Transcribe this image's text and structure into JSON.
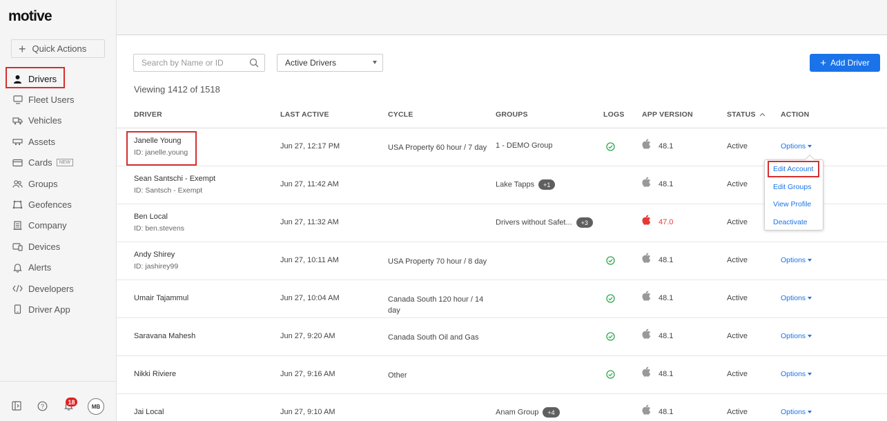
{
  "brand": {
    "logo_text": "motive"
  },
  "sidebar": {
    "quick_actions": "Quick Actions",
    "items": [
      {
        "label": "Drivers",
        "icon": "person-icon"
      },
      {
        "label": "Fleet Users",
        "icon": "monitor-icon"
      },
      {
        "label": "Vehicles",
        "icon": "truck-icon"
      },
      {
        "label": "Assets",
        "icon": "trailer-icon"
      },
      {
        "label": "Cards",
        "icon": "card-icon",
        "badge": "NEW"
      },
      {
        "label": "Groups",
        "icon": "groups-icon"
      },
      {
        "label": "Geofences",
        "icon": "geofence-icon"
      },
      {
        "label": "Company",
        "icon": "building-icon"
      },
      {
        "label": "Devices",
        "icon": "devices-icon"
      },
      {
        "label": "Alerts",
        "icon": "bell-icon"
      },
      {
        "label": "Developers",
        "icon": "code-icon"
      },
      {
        "label": "Driver App",
        "icon": "phone-icon"
      }
    ],
    "footer": {
      "notifications_count": "18",
      "avatar_initials": "MB"
    }
  },
  "toolbar": {
    "search_placeholder": "Search by Name or ID",
    "filter_selected": "Active Drivers",
    "add_driver": "Add Driver",
    "viewing": "Viewing 1412 of 1518"
  },
  "table": {
    "headers": [
      "DRIVER",
      "LAST ACTIVE",
      "CYCLE",
      "GROUPS",
      "LOGS",
      "APP VERSION",
      "STATUS",
      "ACTION"
    ],
    "rows": [
      {
        "name": "Janelle Young",
        "id": "ID: janelle.young",
        "last_active": "Jun 27, 12:17 PM",
        "cycle": "USA Property 60 hour / 7 day",
        "group": "1 - DEMO Group",
        "pill": "",
        "logs_ok": true,
        "version": "48.1",
        "version_bad": false,
        "status": "Active",
        "action": "Options"
      },
      {
        "name": "Sean Santschi - Exempt",
        "id": "ID: Santsch - Exempt",
        "last_active": "Jun 27, 11:42 AM",
        "cycle": "",
        "group": "Lake Tapps",
        "pill": "+1",
        "logs_ok": false,
        "version": "48.1",
        "version_bad": false,
        "status": "Active",
        "action": ""
      },
      {
        "name": "Ben Local",
        "id": "ID: ben.stevens",
        "last_active": "Jun 27, 11:32 AM",
        "cycle": "",
        "group": "Drivers without Safet...",
        "pill": "+3",
        "logs_ok": false,
        "version": "47.0",
        "version_bad": true,
        "status": "Active",
        "action": ""
      },
      {
        "name": "Andy Shirey",
        "id": "ID: jashirey99",
        "last_active": "Jun 27, 10:11 AM",
        "cycle": "USA Property 70 hour / 8 day",
        "group": "",
        "pill": "",
        "logs_ok": true,
        "version": "48.1",
        "version_bad": false,
        "status": "Active",
        "action": "Options"
      },
      {
        "name": "Umair Tajammul",
        "id": "",
        "last_active": "Jun 27, 10:04 AM",
        "cycle": "Canada South 120 hour / 14 day",
        "group": "",
        "pill": "",
        "logs_ok": true,
        "version": "48.1",
        "version_bad": false,
        "status": "Active",
        "action": "Options"
      },
      {
        "name": "Saravana Mahesh",
        "id": "",
        "last_active": "Jun 27, 9:20 AM",
        "cycle": "Canada South Oil and Gas",
        "group": "",
        "pill": "",
        "logs_ok": true,
        "version": "48.1",
        "version_bad": false,
        "status": "Active",
        "action": "Options"
      },
      {
        "name": "Nikki Riviere",
        "id": "",
        "last_active": "Jun 27, 9:16 AM",
        "cycle": "Other",
        "group": "",
        "pill": "",
        "logs_ok": true,
        "version": "48.1",
        "version_bad": false,
        "status": "Active",
        "action": "Options"
      },
      {
        "name": "Jai Local",
        "id": "",
        "last_active": "Jun 27, 9:10 AM",
        "cycle": "",
        "group": "Anam Group",
        "pill": "+4",
        "logs_ok": false,
        "version": "48.1",
        "version_bad": false,
        "status": "Active",
        "action": "Options"
      }
    ]
  },
  "options_menu": {
    "items": [
      "Edit Account",
      "Edit Groups",
      "View Profile",
      "Deactivate"
    ]
  },
  "colors": {
    "accent": "#1a73e8",
    "highlight": "#d32f2f",
    "ok": "#2eaa4f",
    "bad_version": "#e53935"
  }
}
